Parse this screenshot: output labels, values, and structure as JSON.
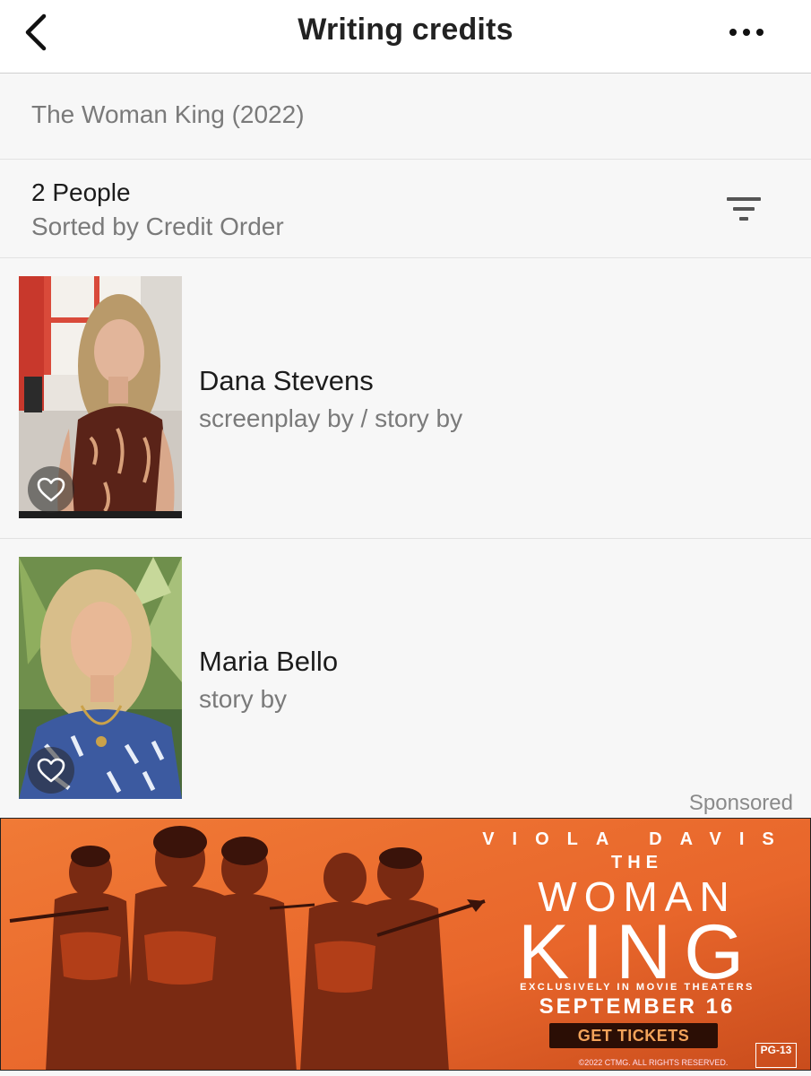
{
  "header": {
    "title": "Writing credits",
    "back_icon": "chevron-left-icon",
    "more_icon": "more-horizontal-icon"
  },
  "movie": {
    "title": "The Woman King (2022)"
  },
  "summary": {
    "count": "2 People",
    "sort": "Sorted by Credit Order",
    "filter_icon": "filter-icon"
  },
  "people": [
    {
      "name": "Dana Stevens",
      "role": "screenplay by / story by"
    },
    {
      "name": "Maria Bello",
      "role": "story by"
    }
  ],
  "ad": {
    "sponsored_label": "Sponsored",
    "actor": "VIOLA DAVIS",
    "title_line1": "THE",
    "title_line2": "WOMAN",
    "title_line3": "KING",
    "release_note": "EXCLUSIVELY IN MOVIE THEATERS",
    "release_date": "SEPTEMBER 16",
    "cta": "GET TICKETS",
    "copyright": "©2022 CTMG. ALL RIGHTS RESERVED.",
    "rating": "PG-13"
  },
  "colors": {
    "ad_orange": "#e8662b",
    "ad_dark": "#2b0e05",
    "muted_text": "#7a7a7a"
  }
}
